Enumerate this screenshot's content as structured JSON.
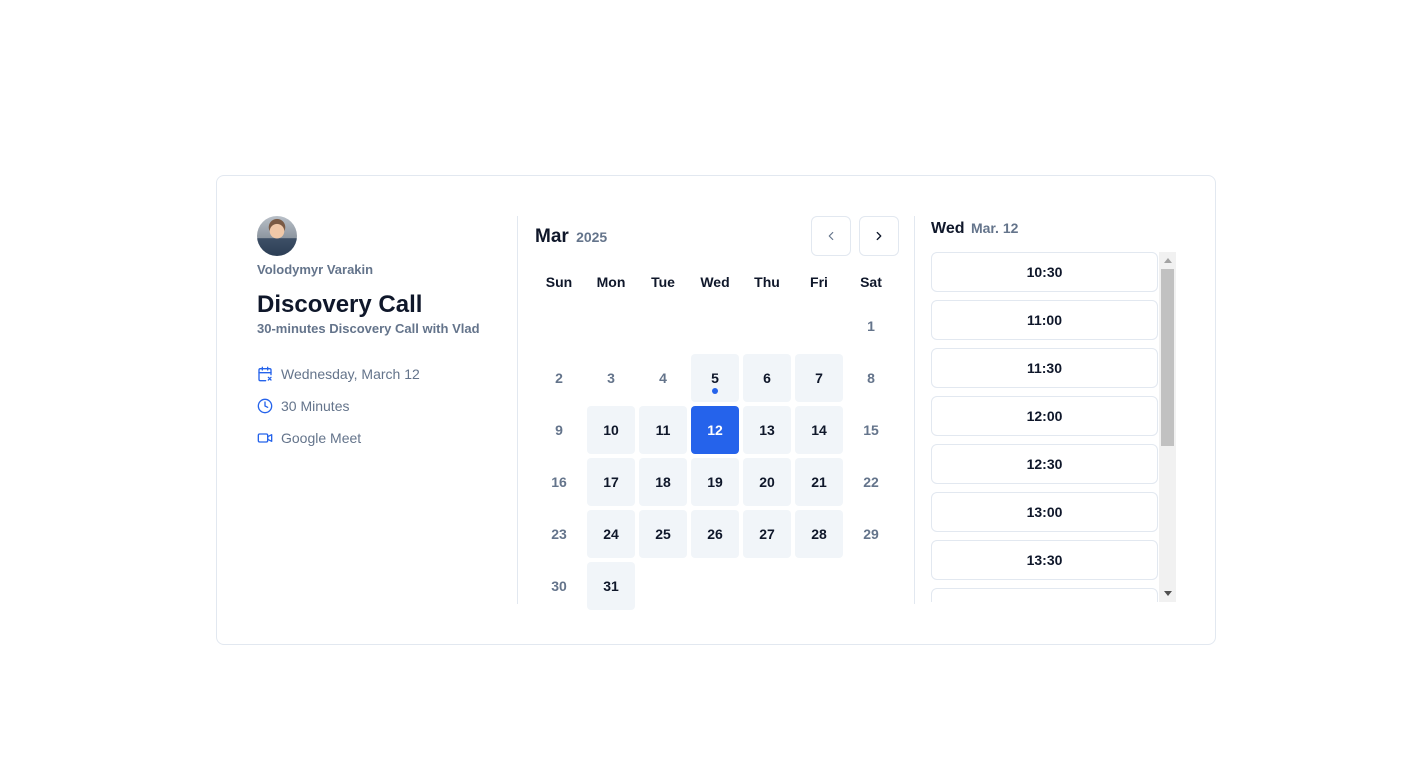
{
  "host": {
    "name": "Volodymyr Varakin"
  },
  "event": {
    "title": "Discovery Call",
    "description": "30-minutes Discovery Call with Vlad",
    "details": [
      {
        "icon": "calendar-x-icon",
        "text": "Wednesday, March 12"
      },
      {
        "icon": "clock-icon",
        "text": "30 Minutes"
      },
      {
        "icon": "video-camera-icon",
        "text": "Google Meet"
      }
    ]
  },
  "calendar": {
    "month": "Mar",
    "year": "2025",
    "weekdays": [
      "Sun",
      "Mon",
      "Tue",
      "Wed",
      "Thu",
      "Fri",
      "Sat"
    ],
    "first_weekday_index": 6,
    "days_in_month": 31,
    "available_days": [
      5,
      6,
      7,
      10,
      11,
      13,
      14,
      17,
      18,
      19,
      20,
      21,
      24,
      25,
      26,
      27,
      28,
      31
    ],
    "selected_day": 12,
    "today_day": 5
  },
  "times": {
    "weekday": "Wed",
    "date": "Mar. 12",
    "slots": [
      "10:30",
      "11:00",
      "11:30",
      "12:00",
      "12:30",
      "13:00",
      "13:30",
      ""
    ]
  },
  "colors": {
    "accent": "#2563eb",
    "muted": "#64748b",
    "available_bg": "#f1f5f9"
  }
}
